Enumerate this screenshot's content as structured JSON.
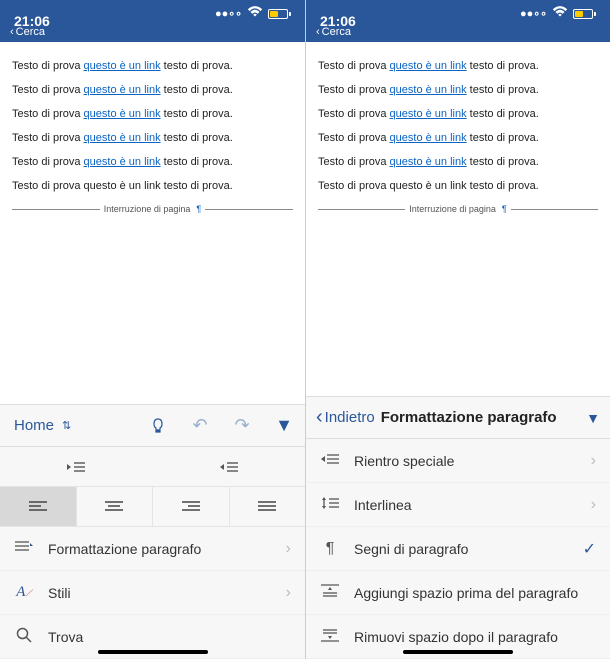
{
  "status": {
    "time": "21:06",
    "back_label": "Cerca"
  },
  "document": {
    "text_before": "Testo di prova ",
    "link_text": "questo è un link",
    "text_after": " testo di prova.",
    "plain_line": "Testo di prova questo è un link testo di prova.",
    "page_break_label": "Interruzione di pagina",
    "pilcrow": "¶"
  },
  "left_toolbar": {
    "home_label": "Home",
    "menu": {
      "formattazione": "Formattazione paragrafo",
      "stili": "Stili",
      "trova": "Trova"
    }
  },
  "right_panel": {
    "back_label": "Indietro",
    "title": "Formattazione paragrafo",
    "items": {
      "rientro": "Rientro speciale",
      "interlinea": "Interlinea",
      "segni": "Segni di paragrafo",
      "aggiungi": "Aggiungi spazio prima del paragrafo",
      "rimuovi": "Rimuovi spazio dopo il paragrafo"
    }
  }
}
